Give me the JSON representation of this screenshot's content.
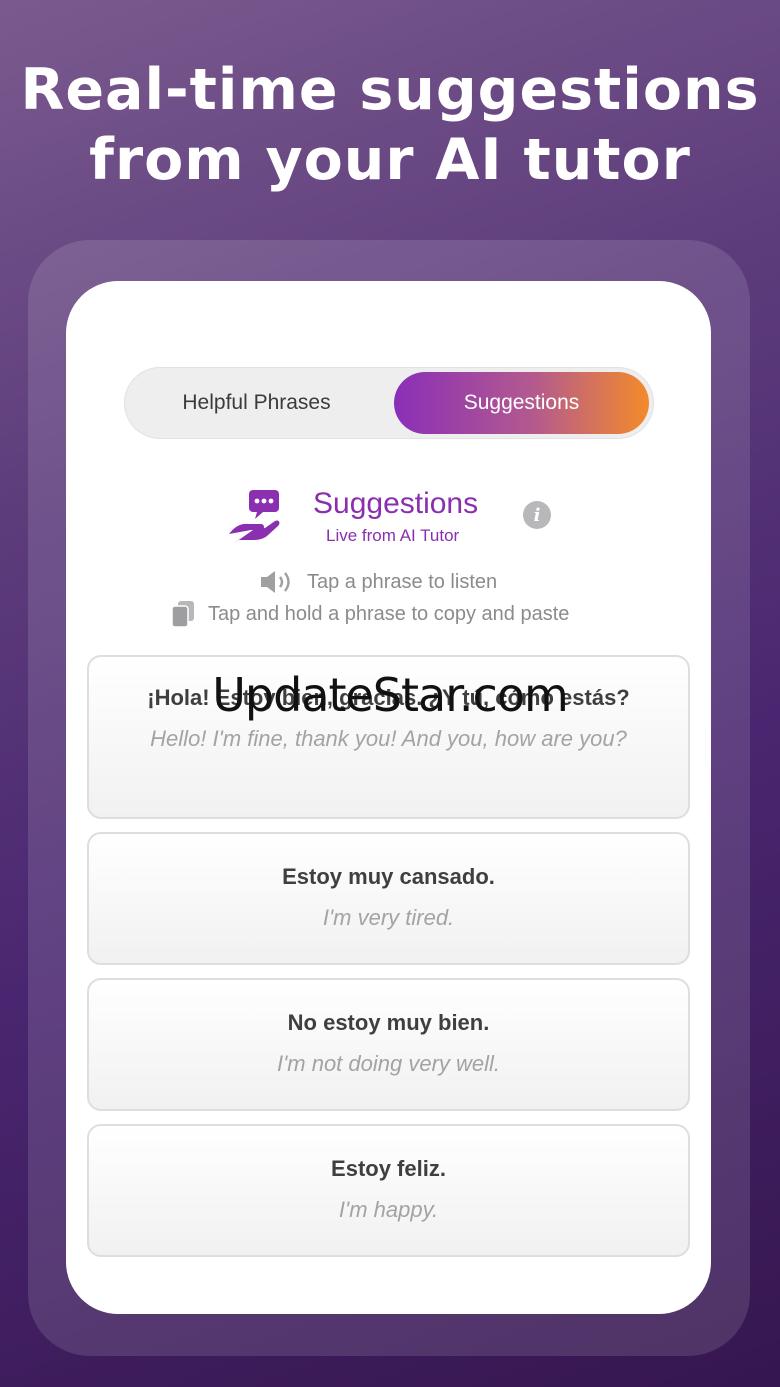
{
  "headline": {
    "line1": "Real-time suggestions",
    "line2": "from your AI tutor"
  },
  "tabs": {
    "left": "Helpful Phrases",
    "right": "Suggestions",
    "active": "Suggestions"
  },
  "section": {
    "title": "Suggestions",
    "subtitle": "Live from AI Tutor",
    "icon": "chat-hand-icon",
    "info_icon": "info-icon"
  },
  "hints": [
    {
      "icon": "speaker-icon",
      "text": "Tap a phrase to listen"
    },
    {
      "icon": "copy-icon",
      "text": "Tap and hold a phrase to copy and paste"
    }
  ],
  "phrases": [
    {
      "es": "¡Hola! Estoy bien, gracias. ¿Y tú, cómo estás?",
      "en": "Hello! I'm fine, thank you! And you, how are you?"
    },
    {
      "es": "Estoy muy cansado.",
      "en": "I'm very tired."
    },
    {
      "es": "No estoy muy bien.",
      "en": "I'm not doing very well."
    },
    {
      "es": "Estoy feliz.",
      "en": "I'm happy."
    }
  ],
  "watermark": "UpdateStar.com",
  "colors": {
    "accent_purple": "#8a2fb0",
    "gradient_start": "#8a2fb7",
    "gradient_end": "#f48a2a",
    "background": "#4a2670"
  }
}
